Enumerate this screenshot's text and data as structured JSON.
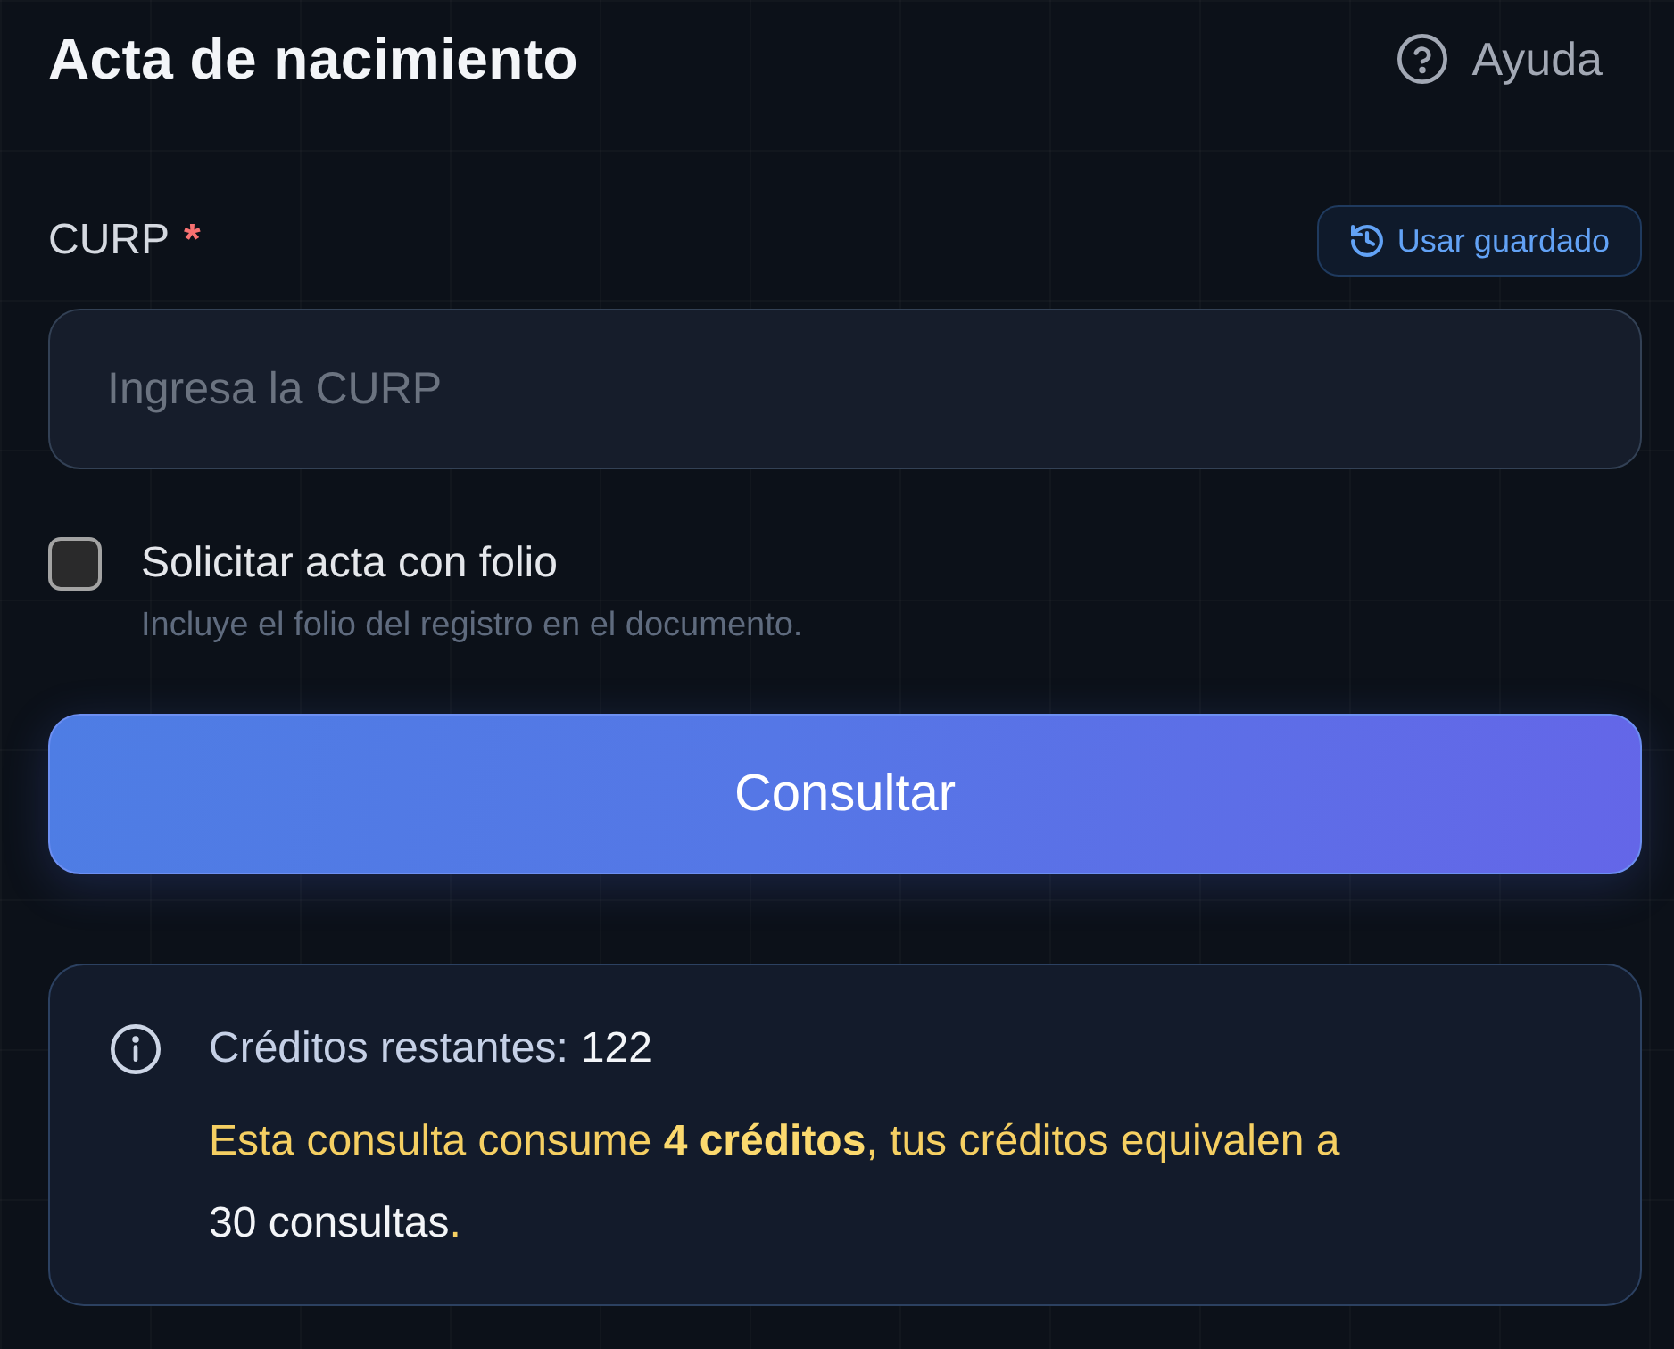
{
  "header": {
    "title": "Acta de nacimiento",
    "help_link": "Ayuda"
  },
  "curp_field": {
    "label": "CURP",
    "required": true,
    "required_mark": "*",
    "saved_button": "Usar guardado",
    "placeholder": "Ingresa la CURP"
  },
  "folio_option": {
    "label": "Solicitar acta con folio",
    "hint": "Incluye el folio del registro en el documento.",
    "checked": false
  },
  "submit_button": "Consultar",
  "credits_panel": {
    "label": "Créditos restantes:",
    "value": "122",
    "notice": "Esta consulta consume **4 créditos**, tus créditos equivalen a",
    "notice_result": "30 consultas",
    "notice_end": "."
  }
}
